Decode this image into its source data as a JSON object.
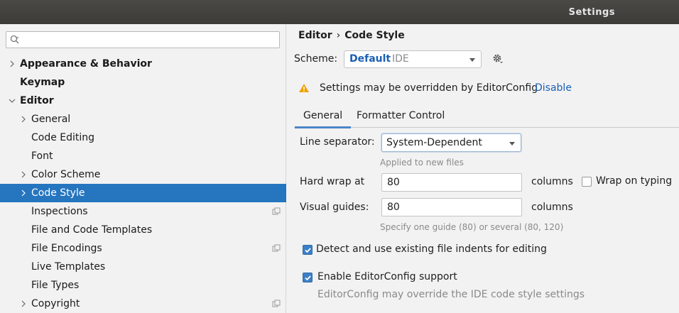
{
  "window": {
    "title": "Settings"
  },
  "search": {
    "placeholder": ""
  },
  "sidebar": {
    "items": [
      {
        "label": "Appearance & Behavior"
      },
      {
        "label": "Keymap"
      },
      {
        "label": "Editor"
      },
      {
        "label": "General"
      },
      {
        "label": "Code Editing"
      },
      {
        "label": "Font"
      },
      {
        "label": "Color Scheme"
      },
      {
        "label": "Code Style"
      },
      {
        "label": "Inspections"
      },
      {
        "label": "File and Code Templates"
      },
      {
        "label": "File Encodings"
      },
      {
        "label": "Live Templates"
      },
      {
        "label": "File Types"
      },
      {
        "label": "Copyright"
      }
    ]
  },
  "breadcrumb": {
    "parent": "Editor",
    "separator": "›",
    "current": "Code Style"
  },
  "scheme": {
    "label": "Scheme:",
    "name": "Default",
    "kind": "IDE"
  },
  "warning": {
    "text": "Settings may be overridden by EditorConfig",
    "link": "Disable"
  },
  "tabs": [
    {
      "label": "General"
    },
    {
      "label": "Formatter Control"
    }
  ],
  "general": {
    "line_separator": {
      "label": "Line separator:",
      "value": "System-Dependent",
      "hint": "Applied to new files"
    },
    "hard_wrap": {
      "label": "Hard wrap at",
      "value": "80",
      "unit": "columns",
      "wrap_on_typing": "Wrap on typing"
    },
    "visual_guides": {
      "label": "Visual guides:",
      "value": "80",
      "unit": "columns",
      "hint": "Specify one guide (80) or several (80, 120)"
    },
    "detect_indents": {
      "label": "Detect and use existing file indents for editing",
      "checked": true
    },
    "editorconfig": {
      "label": "Enable EditorConfig support",
      "checked": true,
      "hint": "EditorConfig may override the IDE code style settings"
    }
  },
  "colors": {
    "selection": "#2675bf",
    "link": "#1a5fb4",
    "checkbox": "#3d7fc6",
    "warning": "#f0a30a"
  }
}
